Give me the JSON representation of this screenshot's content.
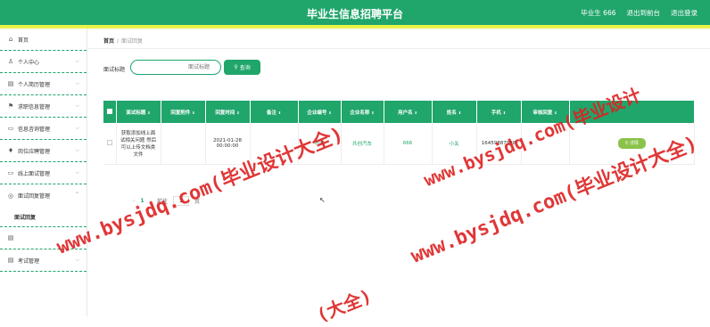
{
  "header": {
    "site_title": "毕业生信息招聘平台",
    "user_label": "毕业生 666",
    "back_label": "退出到前台",
    "logout_label": "退出登录"
  },
  "sidebar": {
    "items": [
      {
        "label": "首页",
        "icon": "home-icon",
        "glyph": "⌂"
      },
      {
        "label": "个人中心",
        "icon": "user-icon",
        "glyph": "♙"
      },
      {
        "label": "个人简历管理",
        "icon": "doc-icon",
        "glyph": "▤"
      },
      {
        "label": "求职信息管理",
        "icon": "flag-icon",
        "glyph": "⚑"
      },
      {
        "label": "信息咨询管理",
        "icon": "chat-icon",
        "glyph": "▭"
      },
      {
        "label": "岗位应聘管理",
        "icon": "mic-icon",
        "glyph": "♦"
      },
      {
        "label": "线上面试管理",
        "icon": "monitor-icon",
        "glyph": "▭"
      },
      {
        "label": "面试回复管理",
        "icon": "circle-icon",
        "glyph": "◎"
      },
      {
        "label": "面试回复",
        "icon": "",
        "glyph": ""
      },
      {
        "label": "考试管理",
        "icon": "folder-icon",
        "glyph": "▤"
      }
    ]
  },
  "breadcrumb": {
    "home": "首页",
    "current": "面试回复"
  },
  "search": {
    "label": "面试标题",
    "placeholder": "面试标题",
    "button": "查询"
  },
  "table": {
    "headers": [
      "面试标题",
      "回复附件",
      "回复时间",
      "备注",
      "企业编号",
      "企业名称",
      "用户名",
      "姓名",
      "手机",
      "审核回复",
      ""
    ],
    "rows": [
      {
        "title": "获取添加线上面试相关问题 然后可以上传文档类文件",
        "attachment": "",
        "time": "2021-01-28 00:00:00",
        "remark": "",
        "company_no": "000",
        "company_name": "共创汽车",
        "username": "666",
        "name": "小关",
        "phone": "16459887988",
        "review": "",
        "action": "详情"
      }
    ]
  },
  "pager": {
    "current": "1",
    "goto_label": "前往",
    "goto_value": "1",
    "page_unit": "页"
  },
  "watermark": {
    "text1": "www.bysjdq.com(毕业设计大全)",
    "text2": "www.bysjdq.com(毕业设计大全)",
    "text3": "www.bysjdq.com(毕业设计",
    "text4": "(大全)"
  },
  "colors": {
    "primary": "#20a56b",
    "accent": "#e8f44a",
    "review_button": "#8bc34a",
    "watermark": "#dd2222"
  }
}
